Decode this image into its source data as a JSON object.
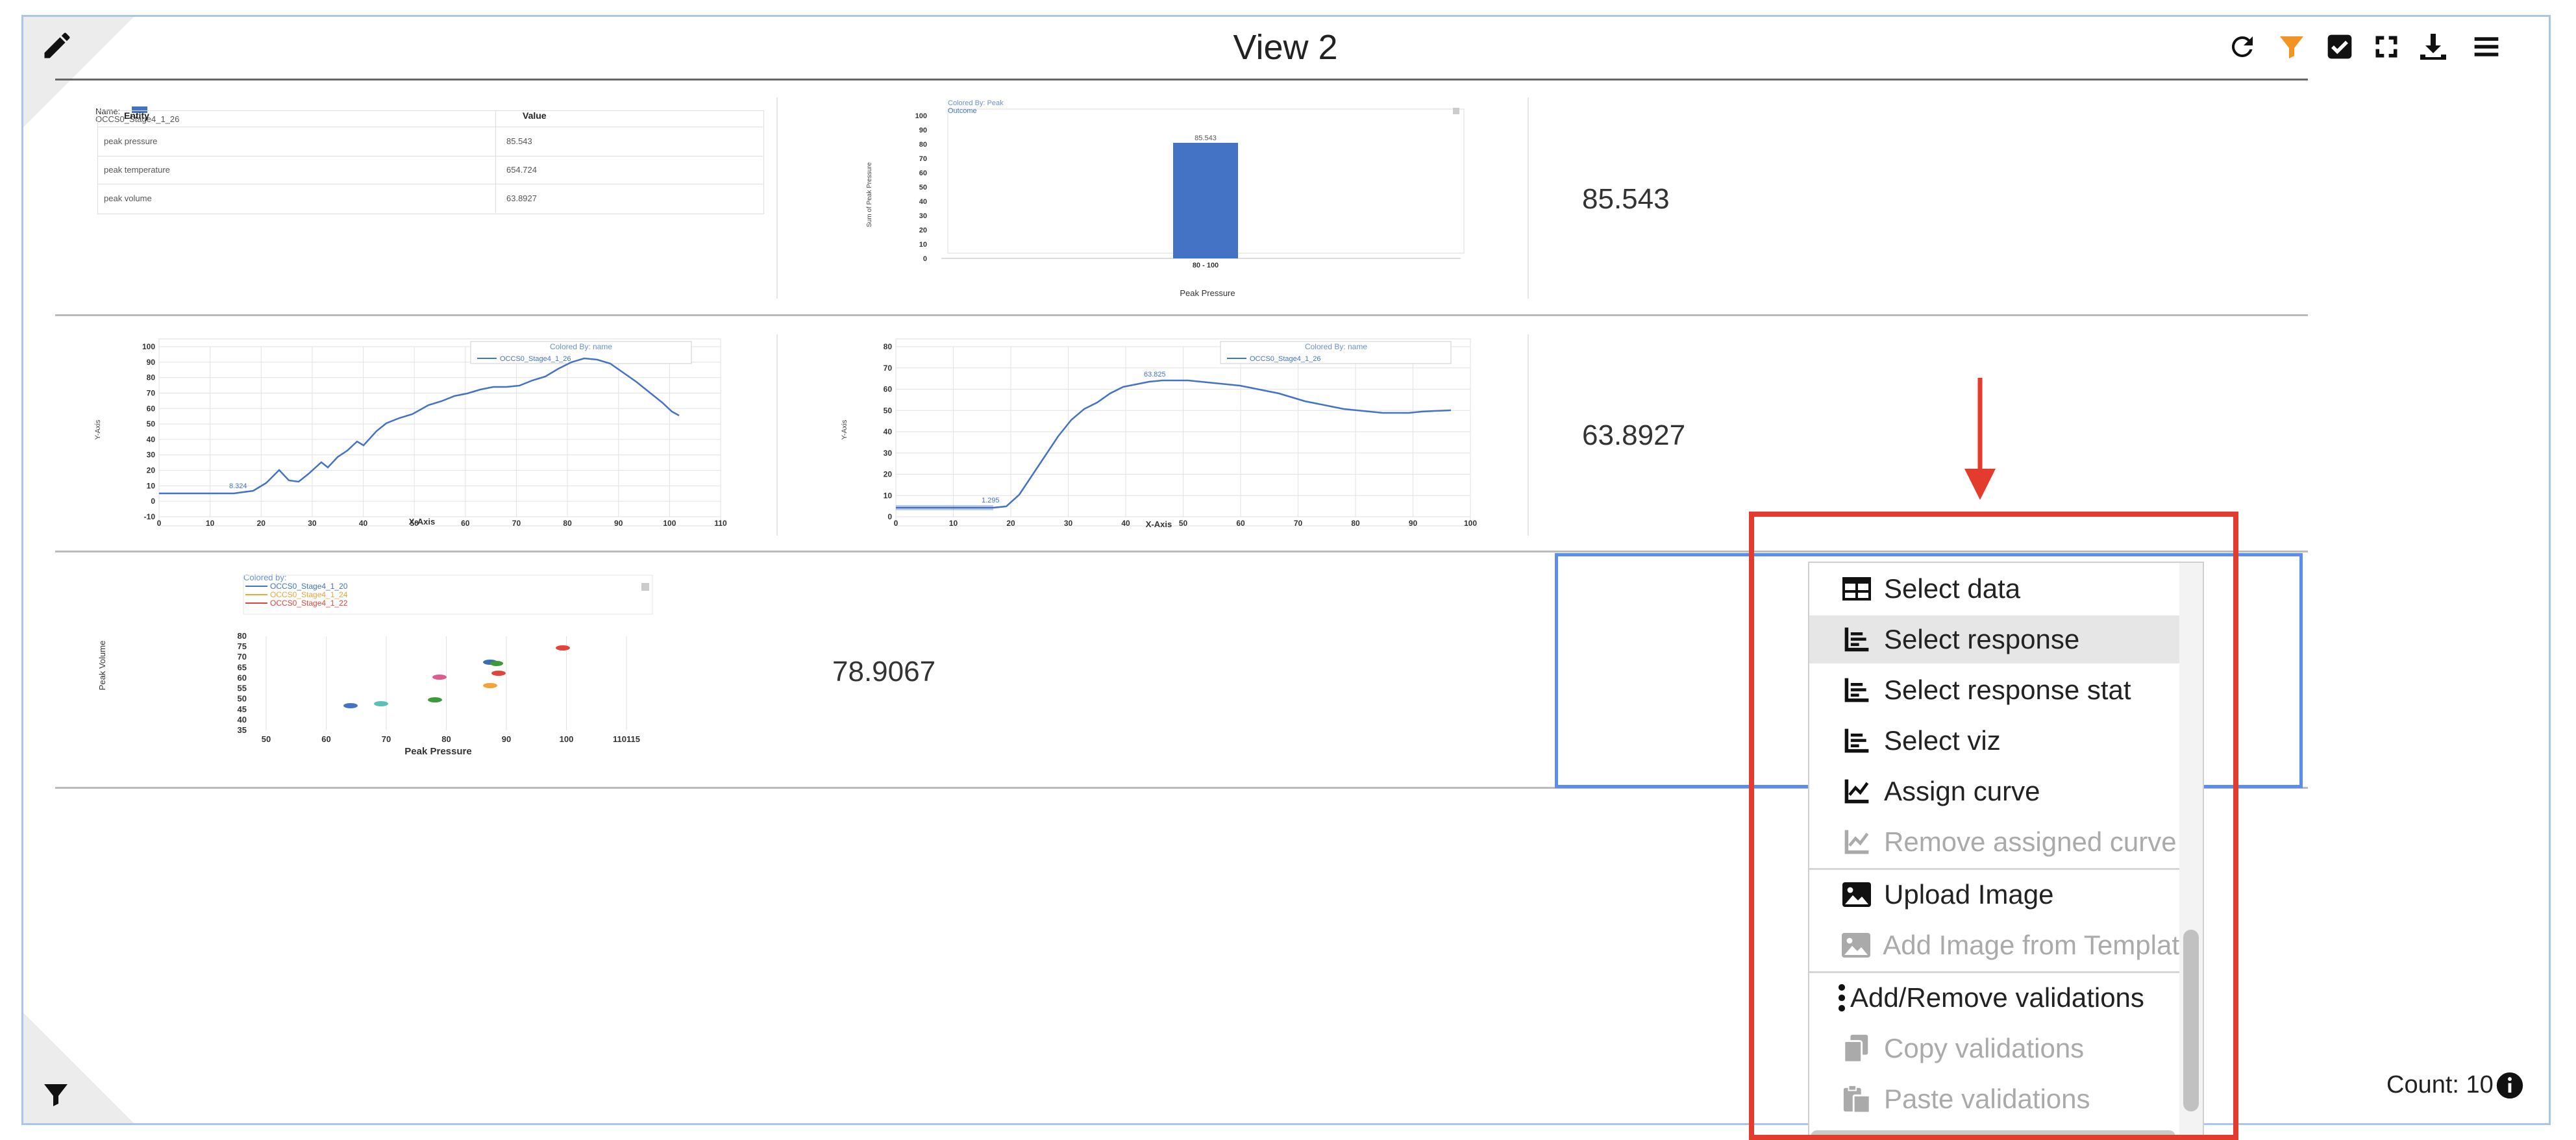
{
  "view": {
    "title": "View 2",
    "count_label": "Count: 10"
  },
  "toolbar": {
    "icons": [
      "refresh-icon",
      "filter-icon",
      "checkbox-icon",
      "fullscreen-icon",
      "download-icon",
      "menu-icon"
    ],
    "accent_color": "#f29423"
  },
  "grid": {
    "row1": {
      "table": {
        "name_label": "Name:",
        "entity_label": "OCCS0_Stage4_1_26",
        "col_entity": "Entity",
        "col_value": "Value",
        "rows": [
          {
            "entity": "peak pressure",
            "value": "85.543"
          },
          {
            "entity": "peak temperature",
            "value": "654.724"
          },
          {
            "entity": "peak volume",
            "value": "63.8927"
          }
        ]
      },
      "bar_chart": {
        "colored_by": "Colored By: Peak",
        "legend": "Outcome",
        "bar_label": "85.543",
        "category": "80 - 100",
        "ylabel": "Sum of Peak Pressure",
        "xlabel": "Peak Pressure",
        "yticks": [
          "0",
          "10",
          "20",
          "30",
          "40",
          "50",
          "60",
          "70",
          "80",
          "90",
          "100"
        ]
      },
      "value": "85.543"
    },
    "row2": {
      "line_chart_1": {
        "colored_by": "Colored By: name",
        "legend": "OCCS0_Stage4_1_26",
        "annotation": "8.324",
        "xlabel": "X-Axis",
        "ylabel": "Y-Axis",
        "xticks": [
          "0",
          "10",
          "20",
          "30",
          "40",
          "50",
          "60",
          "70",
          "80",
          "90",
          "100",
          "110"
        ],
        "yticks": [
          "-10",
          "0",
          "10",
          "20",
          "30",
          "40",
          "50",
          "60",
          "70",
          "80",
          "90",
          "100"
        ]
      },
      "line_chart_2": {
        "colored_by": "Colored By: name",
        "legend": "OCCS0_Stage4_1_26",
        "annotation_peak": "63.825",
        "annotation_low": "1.295",
        "xlabel": "X-Axis",
        "ylabel": "Y-Axis",
        "xticks": [
          "0",
          "10",
          "20",
          "30",
          "40",
          "50",
          "60",
          "70",
          "80",
          "90",
          "100"
        ],
        "yticks": [
          "0",
          "10",
          "20",
          "30",
          "40",
          "50",
          "60",
          "70",
          "80"
        ]
      },
      "value": "63.8927"
    },
    "row3": {
      "scatter_chart": {
        "colored_by": "Colored by:",
        "legend_items": [
          {
            "label": "OCCS0_Stage4_1_20",
            "color": "#4472c4"
          },
          {
            "label": "OCCS0_Stage4_1_24",
            "color": "#f0a43a"
          },
          {
            "label": "OCCS0_Stage4_1_22",
            "color": "#e0443a"
          }
        ],
        "xlabel": "Peak Pressure",
        "ylabel": "Peak Volume",
        "xticks": [
          "50",
          "60",
          "70",
          "80",
          "90",
          "100",
          "110115"
        ],
        "yticks": [
          "35",
          "40",
          "45",
          "50",
          "55",
          "60",
          "65",
          "70",
          "75",
          "80"
        ]
      },
      "value": "78.9067"
    }
  },
  "context_menu": {
    "items": [
      {
        "label": "Select data",
        "icon": "table-icon",
        "state": "normal"
      },
      {
        "label": "Select response",
        "icon": "chart-icon",
        "state": "hover"
      },
      {
        "label": "Select response stat",
        "icon": "chart-icon",
        "state": "normal"
      },
      {
        "label": "Select viz",
        "icon": "chart-icon",
        "state": "normal"
      },
      {
        "label": "Assign curve",
        "icon": "line-chart-icon",
        "state": "normal"
      },
      {
        "label": "Remove assigned curve",
        "icon": "line-chart-icon",
        "state": "disabled"
      },
      {
        "label": "Upload Image",
        "icon": "image-icon",
        "state": "normal"
      },
      {
        "label": "Add Image from Templat",
        "icon": "image-icon",
        "state": "disabled"
      },
      {
        "label": "Add/Remove validations",
        "icon": "vertical-dots-icon",
        "state": "normal"
      },
      {
        "label": "Copy validations",
        "icon": "copy-icon",
        "state": "disabled"
      },
      {
        "label": "Paste validations",
        "icon": "paste-icon",
        "state": "disabled"
      }
    ]
  },
  "annotation": {
    "highlight_color": "#e33b2e"
  }
}
